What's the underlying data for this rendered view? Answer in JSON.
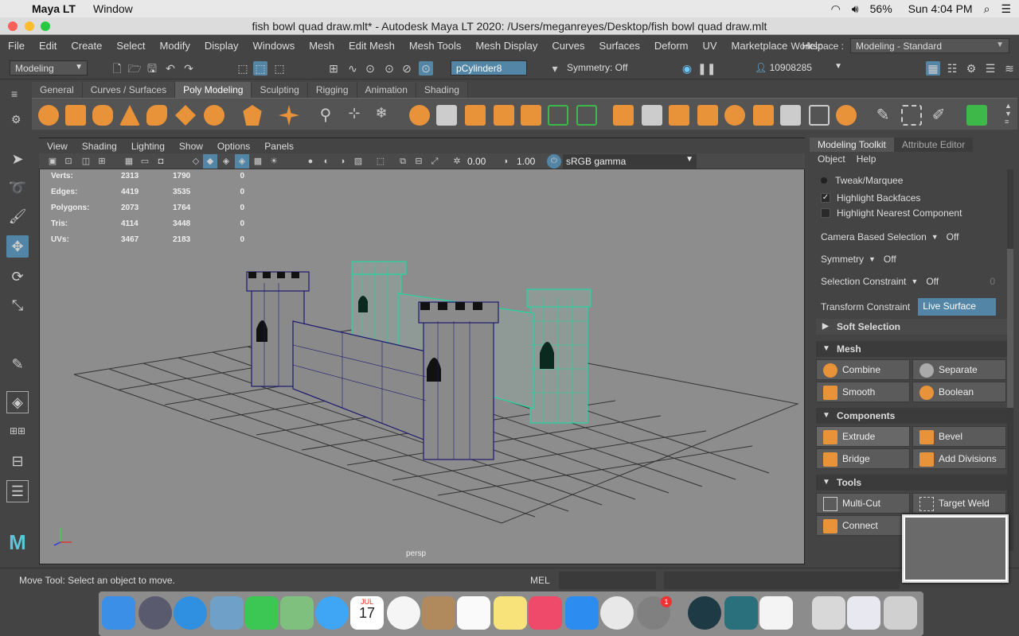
{
  "mac_menubar": {
    "app": "Maya LT",
    "menus": [
      "Window"
    ],
    "battery": "56%",
    "clock": "Sun 4:04 PM"
  },
  "title": "fish bowl quad draw.mlt* - Autodesk Maya LT 2020: /Users/meganreyes/Desktop/fish bowl quad draw.mlt",
  "maya_menus": [
    "File",
    "Edit",
    "Create",
    "Select",
    "Modify",
    "Display",
    "Windows",
    "Mesh",
    "Edit Mesh",
    "Mesh Tools",
    "Mesh Display",
    "Curves",
    "Surfaces",
    "Deform",
    "UV",
    "Marketplace",
    "Help"
  ],
  "workspace": {
    "label": "Workspace :",
    "value": "Modeling - Standard"
  },
  "status_line": {
    "menuset": "Modeling",
    "object_name": "pCylinder8",
    "symmetry": "Symmetry: Off",
    "user_id": "10908285"
  },
  "shelf_tabs": [
    "General",
    "Curves / Surfaces",
    "Poly Modeling",
    "Sculpting",
    "Rigging",
    "Animation",
    "Shading"
  ],
  "shelf_active": "Poly Modeling",
  "viewport": {
    "menus": [
      "View",
      "Shading",
      "Lighting",
      "Show",
      "Options",
      "Panels"
    ],
    "exposure": "0.00",
    "gamma": "1.00",
    "color_space": "sRGB gamma",
    "camera": "persp",
    "hud": [
      {
        "label": "Verts:",
        "a": "2313",
        "b": "1790",
        "c": "0"
      },
      {
        "label": "Edges:",
        "a": "4419",
        "b": "3535",
        "c": "0"
      },
      {
        "label": "Polygons:",
        "a": "2073",
        "b": "1764",
        "c": "0"
      },
      {
        "label": "Tris:",
        "a": "4114",
        "b": "3448",
        "c": "0"
      },
      {
        "label": "UVs:",
        "a": "3467",
        "b": "2183",
        "c": "0"
      }
    ]
  },
  "right_panel": {
    "tabs": [
      "Modeling Toolkit",
      "Attribute Editor"
    ],
    "submenus": [
      "Object",
      "Help"
    ],
    "tweak": "Tweak/Marquee",
    "highlight_backfaces": "Highlight Backfaces",
    "highlight_nearest": "Highlight Nearest Component",
    "camera_based_selection": {
      "label": "Camera Based Selection",
      "value": "Off"
    },
    "symmetry": {
      "label": "Symmetry",
      "value": "Off"
    },
    "selection_constraint": {
      "label": "Selection Constraint",
      "value": "Off",
      "num": "0"
    },
    "transform_constraint": {
      "label": "Transform Constraint",
      "value": "Live Surface"
    },
    "soft_selection": "Soft Selection",
    "sections": {
      "mesh": {
        "title": "Mesh",
        "buttons": [
          "Combine",
          "Separate",
          "Smooth",
          "Boolean"
        ]
      },
      "components": {
        "title": "Components",
        "buttons": [
          "Extrude",
          "Bevel",
          "Bridge",
          "Add Divisions"
        ]
      },
      "tools": {
        "title": "Tools",
        "buttons": [
          "Multi-Cut",
          "Target Weld",
          "Connect"
        ]
      }
    }
  },
  "help_line": "Move Tool: Select an object to move.",
  "command_line": "MEL",
  "dock_badge": "1",
  "calendar": {
    "month": "JUL",
    "day": "17"
  },
  "colors": {
    "accent": "#5285a6",
    "viewport": "#8d8d8d",
    "selected_mesh": "#1fd8a0",
    "mesh_wire": "#1a1a6e"
  }
}
